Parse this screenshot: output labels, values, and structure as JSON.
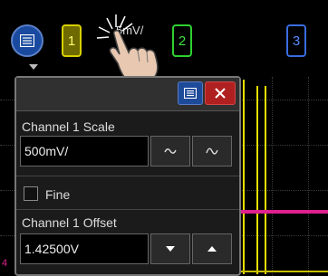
{
  "channels": [
    {
      "label": "1",
      "color": "#d8d000"
    },
    {
      "label": "2",
      "color": "#2fd02f"
    },
    {
      "label": "3",
      "color": "#3a6ce0"
    }
  ],
  "header": {
    "scale_readout": "5mV/"
  },
  "dialog": {
    "scale_label": "Channel 1 Scale",
    "scale_value": "500mV/",
    "fine_label": "Fine",
    "fine_checked": false,
    "offset_label": "Channel 1 Offset",
    "offset_value": "1.42500V"
  },
  "markers": {
    "left_marker": "4"
  },
  "colors": {
    "menu_blue": "#1a4aa0",
    "close_red": "#b02020",
    "trace_pink": "#e0208e",
    "trace_yellow": "#e8e000"
  },
  "icons": {
    "menu": "menu-icon",
    "close": "close-icon",
    "knob_down": "tilde-icon",
    "knob_up": "tilde-up-icon",
    "arrow_down": "arrow-down-icon",
    "arrow_up": "arrow-up-icon",
    "hand": "touch-hand-icon"
  }
}
